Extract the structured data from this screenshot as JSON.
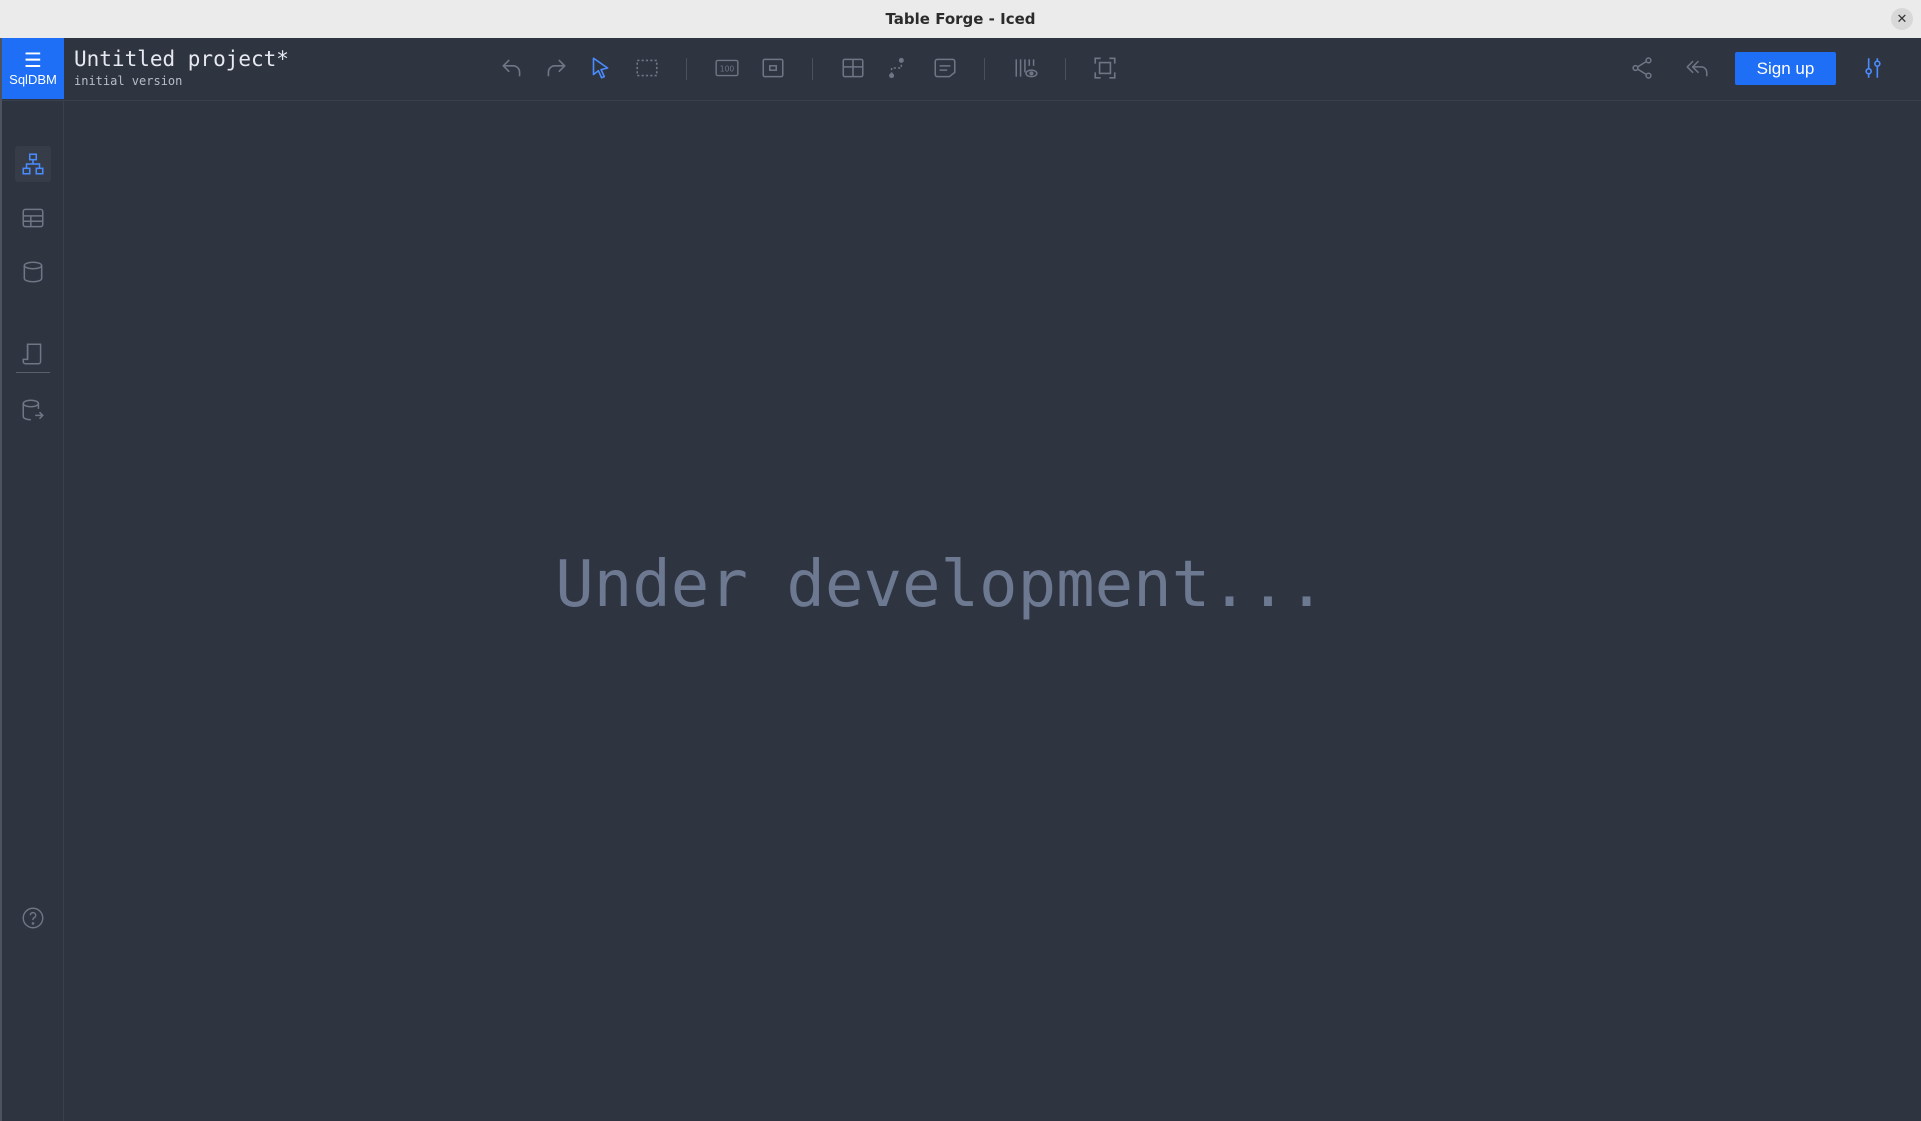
{
  "window": {
    "title": "Table Forge - Iced",
    "close_glyph": "✕"
  },
  "header": {
    "logo": {
      "glyph": "☰",
      "text": "SqlDBM",
      "bg_color": "#1e6ff5"
    },
    "project_name": "Untitled project*",
    "project_version": "initial version",
    "toolbar": [
      {
        "icon": "undo-icon"
      },
      {
        "icon": "redo-icon"
      },
      {
        "icon": "pointer-icon",
        "active": true
      },
      {
        "icon": "box-select-icon"
      },
      {
        "icon": "zoom-100-icon",
        "label": "100"
      },
      {
        "icon": "fit-small-icon"
      },
      {
        "icon": "add-table-icon"
      },
      {
        "icon": "add-relation-icon"
      },
      {
        "icon": "add-note-icon"
      },
      {
        "icon": "column-visibility-icon"
      },
      {
        "icon": "fit-screen-icon"
      }
    ],
    "right": {
      "share_icon": "share-icon",
      "reply_all_icon": "reply-all-icon",
      "signup_label": "Sign up",
      "settings_icon": "settings-sliders-icon"
    }
  },
  "sidebar": {
    "items": [
      {
        "icon": "diagram-icon",
        "active": true
      },
      {
        "icon": "tables-icon"
      },
      {
        "icon": "database-icon"
      },
      {
        "icon": "document-icon"
      },
      {
        "icon": "database-export-icon"
      }
    ],
    "help_icon": "help-icon"
  },
  "canvas": {
    "message": "Under development..."
  },
  "colors": {
    "background": "#2e3440",
    "accent": "#1e6ff5",
    "icon": "#6f7686",
    "icon_active": "#4a8cff",
    "message": "#6d7891"
  }
}
